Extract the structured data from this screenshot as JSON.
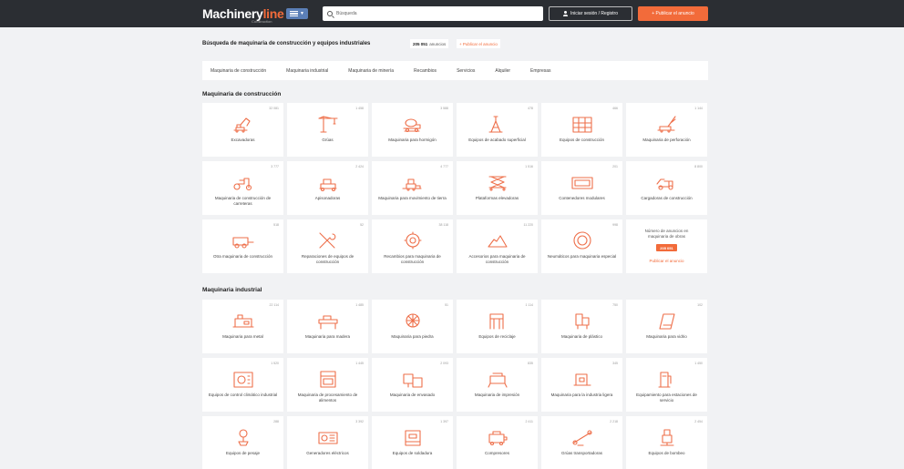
{
  "header": {
    "logo_main": "Machinery",
    "logo_accent": "line",
    "logo_tagline": "Construction",
    "search_placeholder": "Búsqueda",
    "login_label": "Iniciar sesión / Registro",
    "publish_label": "+ Publicar el anuncio",
    "accent_color": "#f26b3a",
    "bar_color": "#2b2e33"
  },
  "headline": {
    "title": "Búsqueda de maquinaria de construcción y equipos industriales",
    "count": "205 051",
    "count_unit": "anuncios",
    "publish_link": "+ Publicar el anuncio"
  },
  "nav": [
    "Maquinaria de construcción",
    "Maquinaria industrial",
    "Maquinaria de minería",
    "Recambios",
    "Servicios",
    "Alquiler",
    "Empresas"
  ],
  "sections": [
    {
      "title": "Maquinaria de construcción",
      "tiles": [
        {
          "label": "Excavadoras",
          "count": "32 081",
          "icon": "excavator-icon"
        },
        {
          "label": "Grúas",
          "count": "1 458",
          "icon": "crane-icon"
        },
        {
          "label": "Maquinaria para hormigón",
          "count": "3 588",
          "icon": "concrete-mixer-icon"
        },
        {
          "label": "Equipos de acabado superficial",
          "count": "478",
          "icon": "surface-finishing-icon"
        },
        {
          "label": "Equipos de construcción",
          "count": "466",
          "icon": "scaffolding-icon"
        },
        {
          "label": "Maquinaria de perforación",
          "count": "1 144",
          "icon": "drilling-rig-icon"
        },
        {
          "label": "Maquinaria de construcción de carreteras",
          "count": "3 777",
          "icon": "road-roller-icon"
        },
        {
          "label": "Apisonadoras",
          "count": "2 424",
          "icon": "compactor-icon"
        },
        {
          "label": "Maquinaria para movimiento de tierra",
          "count": "4 777",
          "icon": "bulldozer-icon"
        },
        {
          "label": "Plataformas elevadoras",
          "count": "1 516",
          "icon": "scissor-lift-icon"
        },
        {
          "label": "Contenedores modulares",
          "count": "201",
          "icon": "container-icon"
        },
        {
          "label": "Cargadoras de construcción",
          "count": "8 800",
          "icon": "wheel-loader-icon"
        },
        {
          "label": "Otra maquinaria de construcción",
          "count": "518",
          "icon": "trailer-icon"
        },
        {
          "label": "Reparaciones de equipos de construcción",
          "count": "52",
          "icon": "wrench-icon"
        },
        {
          "label": "Recambios para maquinaria de construcción",
          "count": "38 118",
          "icon": "gear-icon"
        },
        {
          "label": "Accesorios para maquinaria de construcción",
          "count": "11 220",
          "icon": "bucket-icon"
        },
        {
          "label": "Neumáticos para maquinaria especial",
          "count": "998",
          "icon": "tire-icon"
        }
      ],
      "info": {
        "text": "Número de anuncios en maquinaria de obras",
        "badge": "205 051",
        "link": "Publicar el anuncio"
      }
    },
    {
      "title": "Maquinaria industrial",
      "tiles": [
        {
          "label": "Maquinaria para metal",
          "count": "22 114",
          "icon": "metal-machine-icon"
        },
        {
          "label": "Maquinaria para madera",
          "count": "1 485",
          "icon": "wood-machine-icon"
        },
        {
          "label": "Maquinaria para piedra",
          "count": "51",
          "icon": "stone-machine-icon"
        },
        {
          "label": "Equipos de reciclaje",
          "count": "1 114",
          "icon": "recycling-icon"
        },
        {
          "label": "Maquinaria de plástico",
          "count": "750",
          "icon": "plastic-machine-icon"
        },
        {
          "label": "Maquinaria para vidrio",
          "count": "102",
          "icon": "glass-machine-icon"
        },
        {
          "label": "Equipos de control climático industrial",
          "count": "1 520",
          "icon": "climate-control-icon"
        },
        {
          "label": "Maquinaria de procesamiento de alimentos",
          "count": "1 445",
          "icon": "food-processing-icon"
        },
        {
          "label": "Maquinaria de envasado",
          "count": "2 093",
          "icon": "packaging-icon"
        },
        {
          "label": "Maquinaria de impresión",
          "count": "835",
          "icon": "printing-icon"
        },
        {
          "label": "Maquinaria para la industria ligera",
          "count": "345",
          "icon": "sewing-machine-icon"
        },
        {
          "label": "Equipamiento para estaciones de servicio",
          "count": "1 450",
          "icon": "fuel-station-icon"
        },
        {
          "label": "Equipos de pesaje",
          "count": "288",
          "icon": "scale-icon"
        },
        {
          "label": "Generadores eléctricos",
          "count": "3 392",
          "icon": "generator-icon"
        },
        {
          "label": "Equipos de soldadura",
          "count": "1 397",
          "icon": "welding-icon"
        },
        {
          "label": "Compresores",
          "count": "2 411",
          "icon": "compressor-icon"
        },
        {
          "label": "Grúas transportadoras",
          "count": "2 218",
          "icon": "conveyor-icon"
        },
        {
          "label": "Equipos de bombeo",
          "count": "2 454",
          "icon": "pump-icon"
        }
      ]
    }
  ]
}
